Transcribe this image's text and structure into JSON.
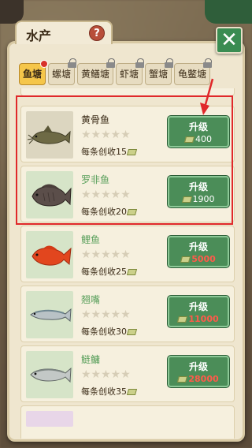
{
  "window": {
    "title": "水产",
    "help_label": "?",
    "close_label": "✕"
  },
  "tabs": [
    {
      "label": "鱼塘",
      "active": true,
      "badge": "new",
      "locked": false
    },
    {
      "label": "螺塘",
      "active": false,
      "locked": true
    },
    {
      "label": "黄鳝塘",
      "active": false,
      "locked": true
    },
    {
      "label": "虾塘",
      "active": false,
      "locked": true
    },
    {
      "label": "蟹塘",
      "active": false,
      "locked": true
    },
    {
      "label": "龟鳖塘",
      "active": false,
      "locked": true
    }
  ],
  "fish": [
    {
      "name": "黄骨鱼",
      "stars": "★★★★★",
      "earn": "每条创收15",
      "upgrade_label": "升级",
      "price": "400",
      "affordable": true,
      "new_name": false,
      "thumb_bg": "#dcd6c0"
    },
    {
      "name": "罗非鱼",
      "stars": "★★★★★",
      "earn": "每条创收20",
      "upgrade_label": "升级",
      "price": "1900",
      "affordable": true,
      "new_name": true,
      "thumb_bg": "#d6e4c8"
    },
    {
      "name": "鲤鱼",
      "stars": "★★★★★",
      "earn": "每条创收25",
      "upgrade_label": "升级",
      "price": "5000",
      "affordable": false,
      "new_name": true,
      "thumb_bg": "#d6e4c8"
    },
    {
      "name": "翘嘴",
      "stars": "★★★★★",
      "earn": "每条创收30",
      "upgrade_label": "升级",
      "price": "11000",
      "affordable": false,
      "new_name": true,
      "thumb_bg": "#d6e4c8"
    },
    {
      "name": "鲢鳙",
      "stars": "★★★★★",
      "earn": "每条创收35",
      "upgrade_label": "升级",
      "price": "28000",
      "affordable": false,
      "new_name": true,
      "thumb_bg": "#d6e4c8"
    }
  ],
  "colors": {
    "accent_green": "#4b8d58",
    "unaffordable_red": "#ff5a4a",
    "highlight_red": "#e0282a",
    "tab_active": "#f5c64a"
  }
}
